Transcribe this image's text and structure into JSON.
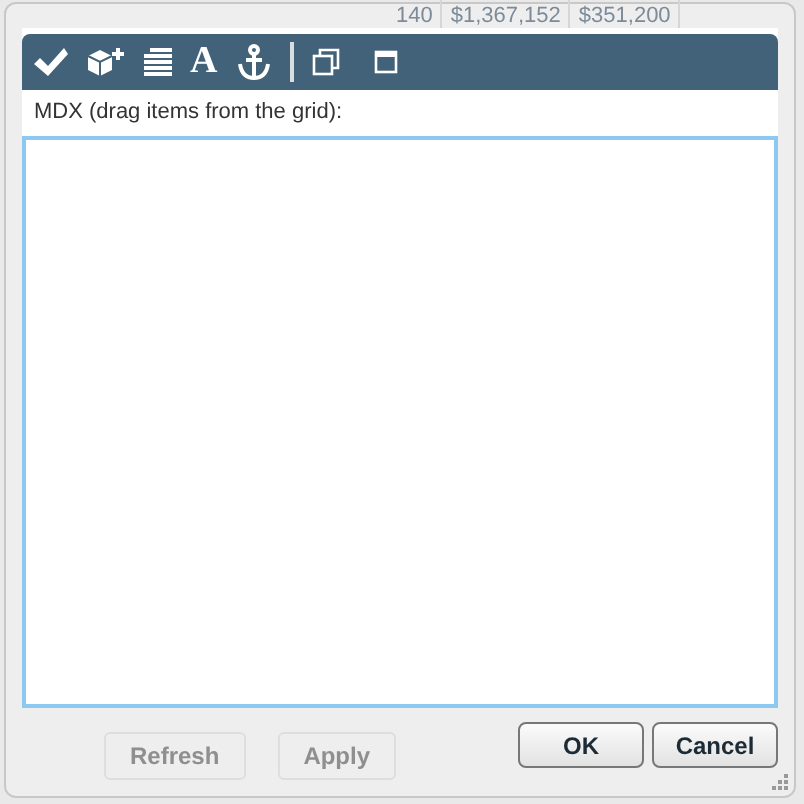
{
  "background": {
    "grid_cells": [
      "140",
      "$1,367,152",
      "$351,200"
    ],
    "buttons": [
      {
        "label": "Refresh",
        "disabled": true
      },
      {
        "label": "Apply",
        "disabled": true
      }
    ]
  },
  "dialog": {
    "toolbar": [
      {
        "kind": "check"
      },
      {
        "kind": "cube-add"
      },
      {
        "kind": "lines"
      },
      {
        "kind": "glyph",
        "text": "A"
      },
      {
        "kind": "anchor"
      },
      {
        "kind": "separator"
      },
      {
        "kind": "windows"
      },
      {
        "kind": "window"
      }
    ],
    "label": "MDX (drag items from the grid):",
    "buttons": [
      "OK",
      "Cancel"
    ]
  }
}
